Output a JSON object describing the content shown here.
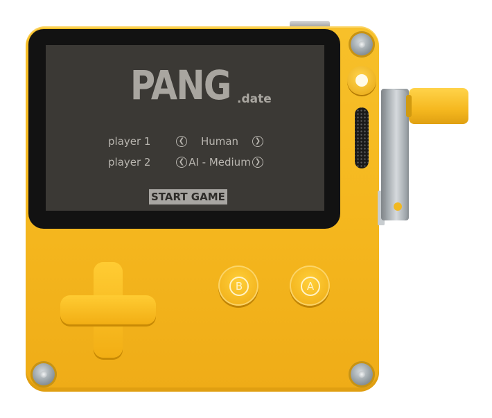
{
  "game": {
    "logo_main": "PANG",
    "logo_sub": ".date",
    "players": [
      {
        "label": "player 1",
        "value": "Human"
      },
      {
        "label": "player 2",
        "value": "AI - Medium"
      }
    ],
    "start_label": "START GAME"
  },
  "device": {
    "buttons": {
      "b_label": "B",
      "a_label": "A"
    },
    "body_color": "#f5b81f",
    "screen_color": "#3b3935"
  }
}
